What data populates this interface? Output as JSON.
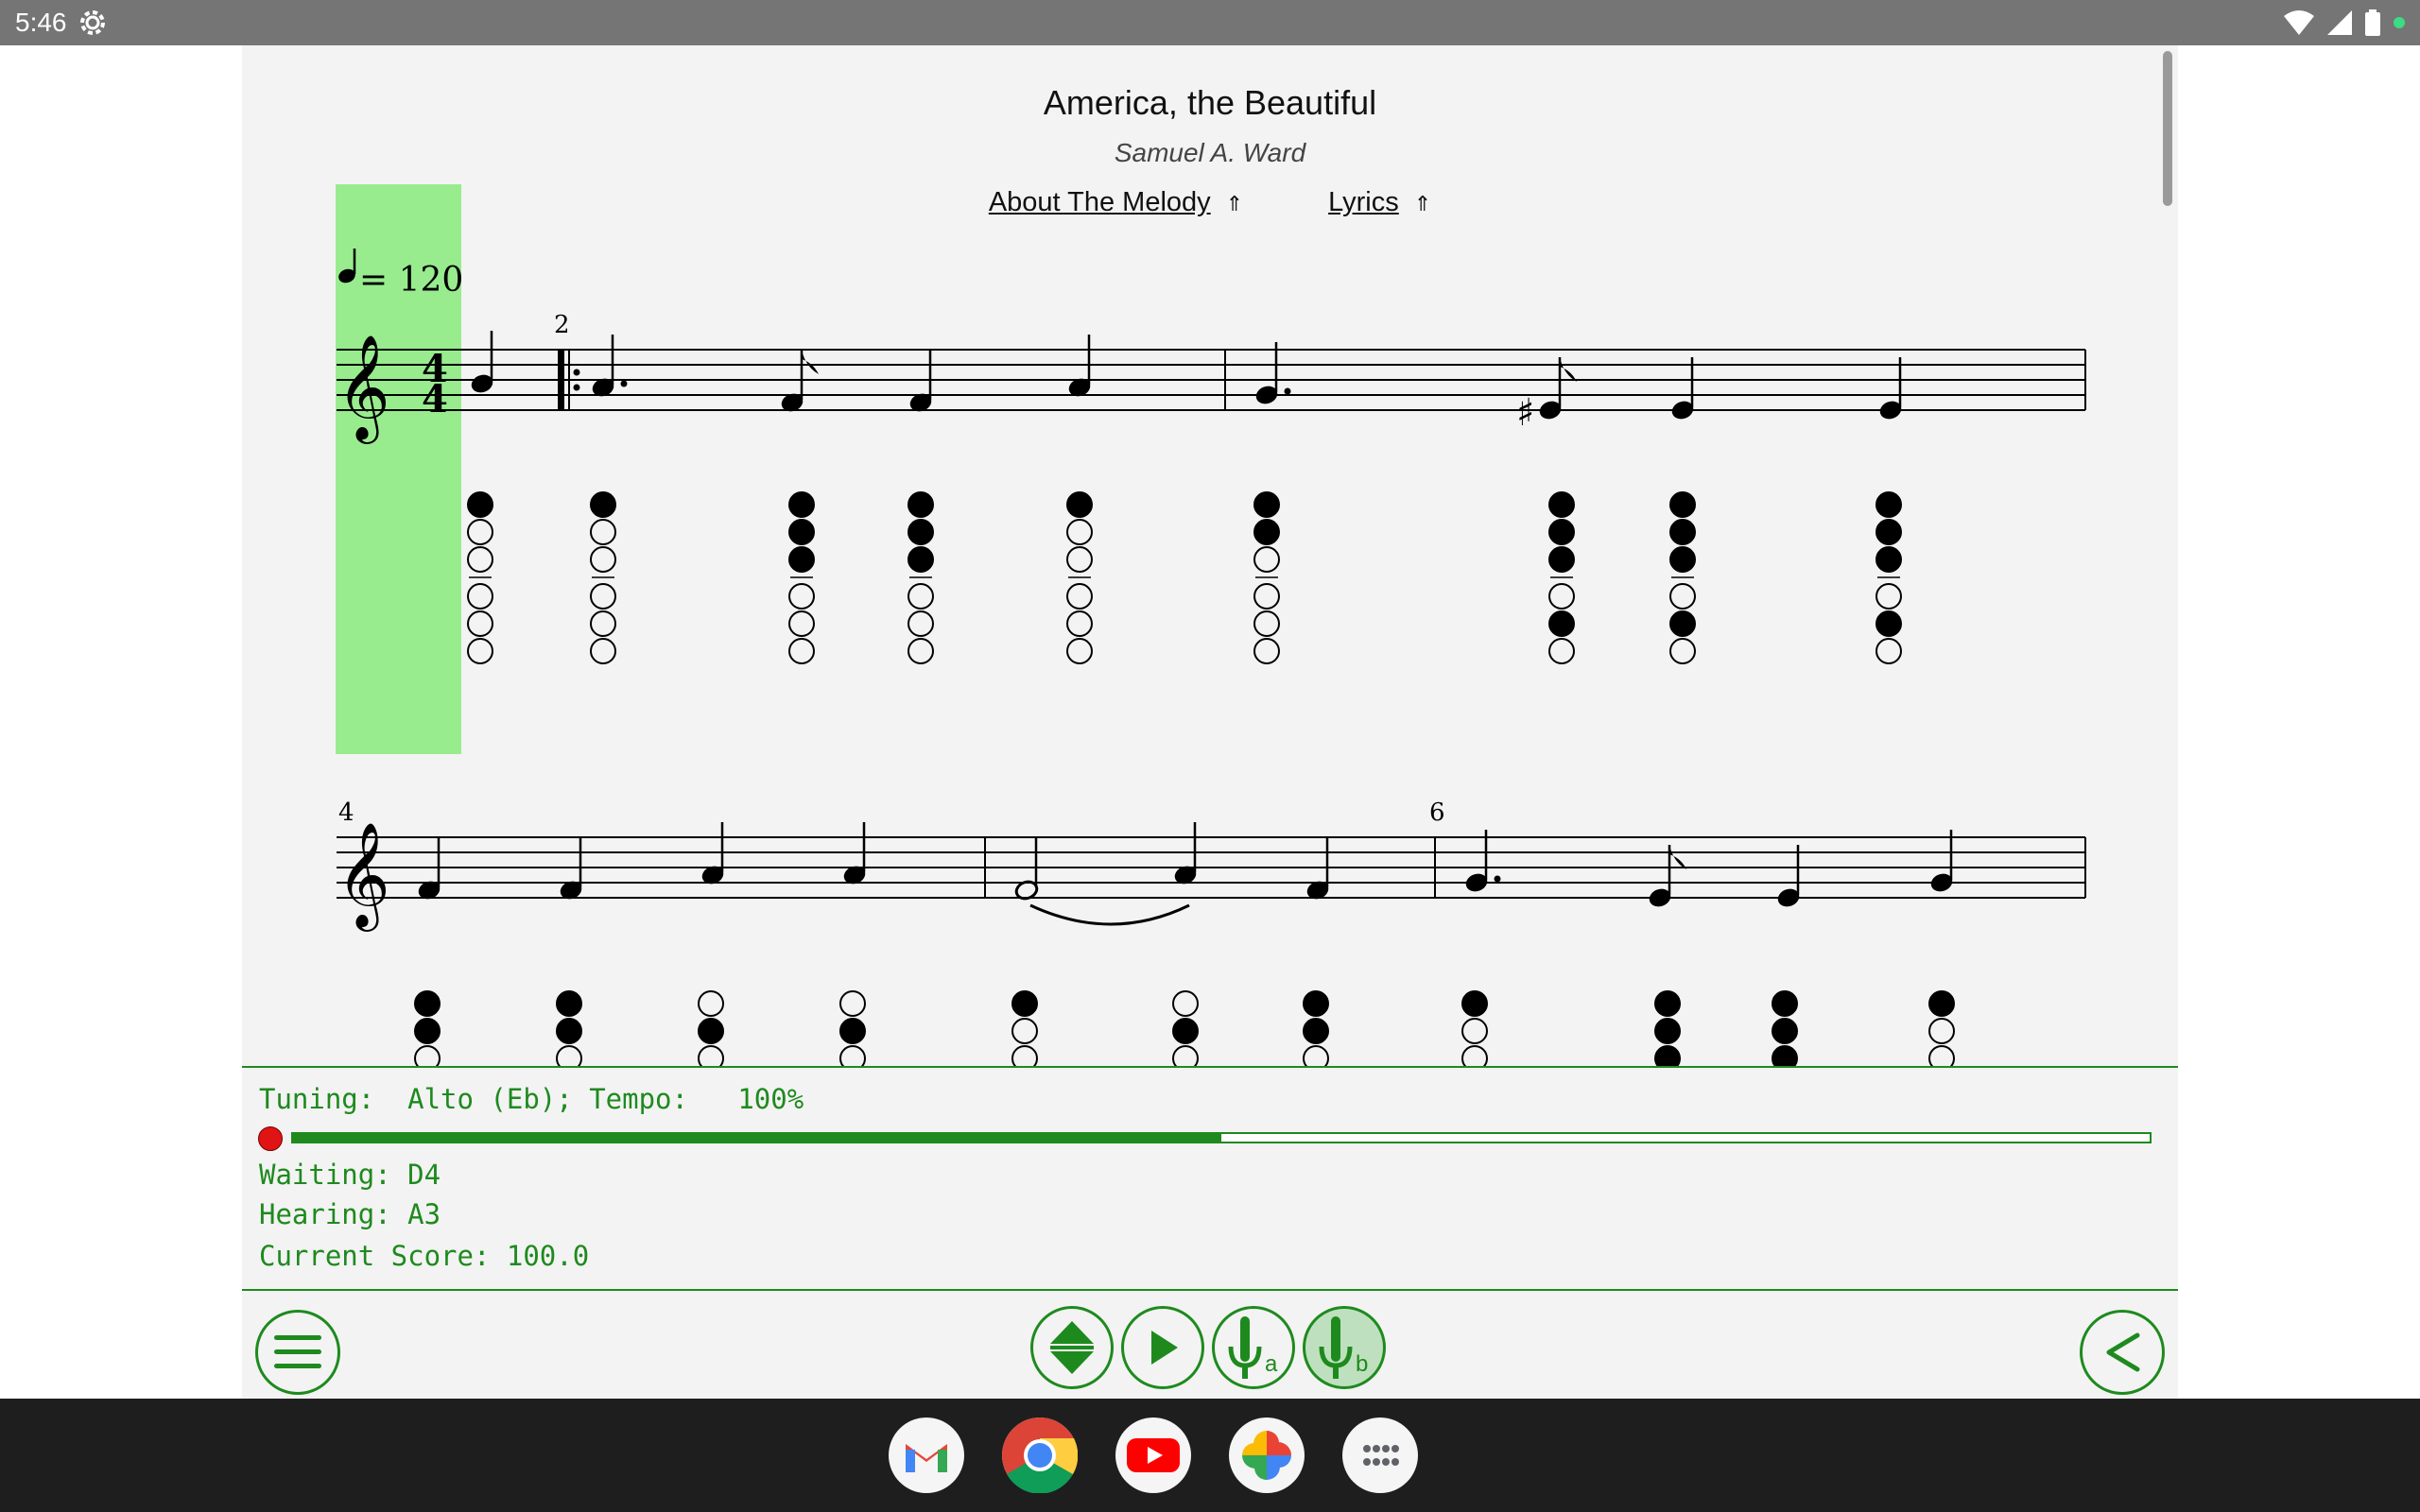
{
  "status_bar": {
    "time": "5:46",
    "icons": [
      "settings-gear-icon",
      "wifi-icon",
      "signal-icon",
      "battery-icon",
      "notification-dot-icon"
    ]
  },
  "song": {
    "title": "America, the Beautiful",
    "composer": "Samuel A. Ward",
    "links": [
      "About The Melody",
      "Lyrics"
    ],
    "link_arrow": "⇑",
    "tempo_mark": "= 120",
    "time_signature": "4/4",
    "measure_numbers": [
      "2",
      "4",
      "6"
    ]
  },
  "status_panel": {
    "line1": "Tuning:  Alto (Eb); Tempo:   100%",
    "progress": 0.5,
    "waiting": "Waiting: D4",
    "hearing": "Hearing: A3",
    "score": "Current Score: 100.0"
  },
  "buttons": {
    "menu": "menu-icon",
    "transpose": "up-down-arrows-icon",
    "play": "play-icon",
    "mic_a": "microphone-a-icon",
    "mic_b": "microphone-b-icon",
    "back": "chevron-left-icon",
    "mic_a_label": "a",
    "mic_b_label": "b"
  },
  "dock": {
    "apps": [
      "Gmail",
      "Chrome",
      "YouTube",
      "Photos",
      "App drawer"
    ]
  },
  "colors": {
    "accent": "#1e8a1e",
    "highlight": "#98ec8e",
    "record": "#e01414"
  }
}
